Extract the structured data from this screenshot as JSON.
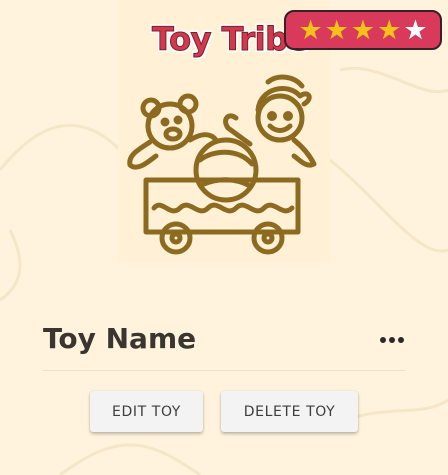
{
  "logo": {
    "text": "Toy Tribe"
  },
  "rating": {
    "value": 4,
    "max": 5,
    "filled_star": "★",
    "empty_star": "★",
    "badge_color": "#d9395a",
    "star_color": "#f6c21a"
  },
  "toy": {
    "name": "Toy Name",
    "illustration": "toy-wagon-icon"
  },
  "menu": {
    "icon": "more-horizontal-icon"
  },
  "actions": {
    "edit_label": "EDIT TOY",
    "delete_label": "DELETE TOY"
  },
  "colors": {
    "background": "#fff3dd",
    "illustration": "#8c6a1f",
    "title_text": "#3b3530"
  }
}
